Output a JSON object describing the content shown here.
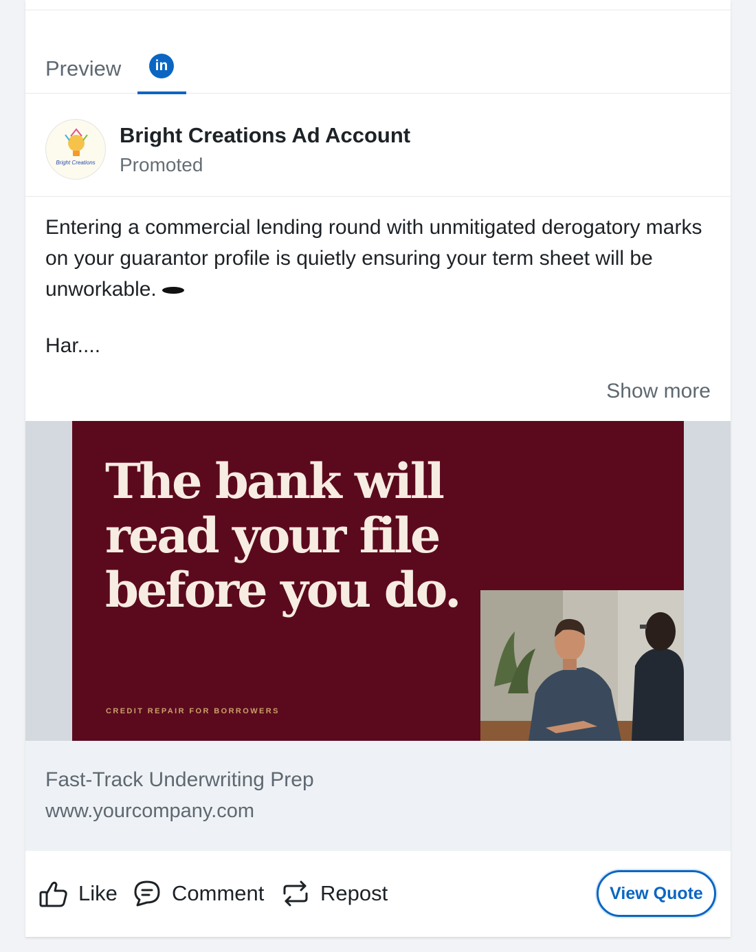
{
  "tabs": {
    "preview_label": "Preview",
    "linkedin_label": "in"
  },
  "account": {
    "name": "Bright Creations Ad Account",
    "status": "Promoted",
    "logo_text": "Bright Creations"
  },
  "post": {
    "text": "Entering a commercial lending round with unmitigated derogatory marks on your guarantor profile is quietly ensuring your term sheet will be unworkable.",
    "continuation": "Har....",
    "show_more": "Show more"
  },
  "creative": {
    "headline": "The bank will read your file before you do.",
    "tagline": "CREDIT REPAIR FOR BORROWERS"
  },
  "link": {
    "title": "Fast-Track Underwriting Prep",
    "url": "www.yourcompany.com"
  },
  "actions": {
    "like": "Like",
    "comment": "Comment",
    "repost": "Repost",
    "cta": "View Quote"
  },
  "colors": {
    "accent": "#0a66c2",
    "creative_bg": "#5b0a1e",
    "headline": "#f7ece2",
    "tagline": "#c9a16a"
  }
}
